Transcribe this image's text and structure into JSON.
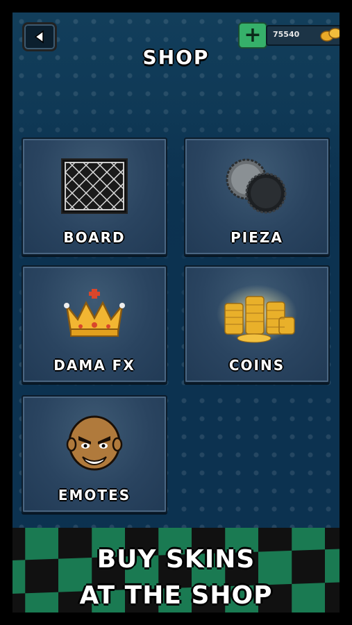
{
  "header": {
    "title": "SHOP",
    "back_icon": "back-arrow-icon",
    "coins": "75540",
    "add_icon": "plus-icon",
    "coin_icon": "coins-icon"
  },
  "categories": [
    {
      "label": "BOARD",
      "icon": "board-grid-icon"
    },
    {
      "label": "PIEZA",
      "icon": "dama-pieces-icon"
    },
    {
      "label": "DAMA FX",
      "icon": "crown-icon"
    },
    {
      "label": "COINS",
      "icon": "coin-stacks-icon"
    },
    {
      "label": "EMOTES",
      "icon": "face-emote-icon"
    }
  ],
  "banner": {
    "line1": "BUY SKINS",
    "line2": "AT THE SHOP"
  },
  "colors": {
    "background": "#0e3a55",
    "card": "#2a4460",
    "plus_button": "#36b06a",
    "banner_green": "#1a7a52"
  }
}
